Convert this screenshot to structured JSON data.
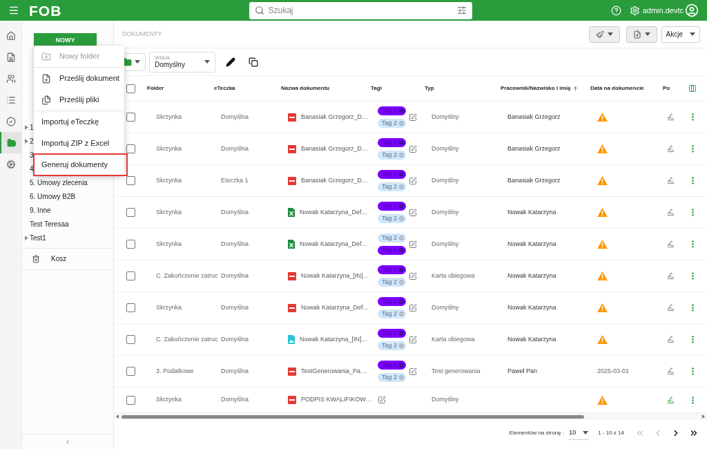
{
  "top_bar": {
    "logo": "FOB",
    "search": {
      "placeholder": "Szukaj"
    },
    "user": "admin.devtc"
  },
  "rail": [
    {
      "selected": false
    },
    {
      "selected": false
    },
    {
      "selected": false
    },
    {
      "selected": false
    },
    {
      "selected": false
    },
    {
      "selected": true
    },
    {
      "selected": false
    }
  ],
  "sidebar": {
    "new_button": "NOWY",
    "tree": [
      {
        "label": "1",
        "expandable": true
      },
      {
        "label": "2",
        "expandable": true
      },
      {
        "label": "3",
        "expandable": false
      },
      {
        "label": "4",
        "expandable": false
      },
      {
        "label": "5. Umowy zlecenia",
        "expandable": false
      },
      {
        "label": "6. Umowy B2B",
        "expandable": false
      },
      {
        "label": "9. Inne",
        "expandable": false
      },
      {
        "label": "Test Teresaa",
        "expandable": false
      },
      {
        "label": "Test1",
        "expandable": true
      }
    ],
    "trash": "Kosz"
  },
  "new_menu": {
    "sections": [
      [
        {
          "label": "Nowy folder",
          "kind": "folder",
          "disabled": true,
          "highlighted": false
        }
      ],
      [
        {
          "label": "Prześlij dokument",
          "kind": "upload",
          "disabled": false,
          "highlighted": false
        },
        {
          "label": "Prześlij pliki",
          "kind": "files",
          "disabled": false,
          "highlighted": false
        }
      ],
      [
        {
          "label": "Importuj eTeczkę",
          "disabled": false,
          "highlighted": false
        },
        {
          "label": "Importuj ZIP z Excel",
          "disabled": false,
          "highlighted": false
        },
        {
          "label": "Generuj dokumenty",
          "disabled": false,
          "highlighted": true
        }
      ]
    ]
  },
  "breadcrumb": "DOKUMENTY",
  "actions_button": "Akcje",
  "view_select": {
    "label": "Widok",
    "value": "Domyślny"
  },
  "table": {
    "columns": [
      {
        "label": "Folder",
        "sorted": false
      },
      {
        "label": "eTeczka",
        "sorted": false
      },
      {
        "label": "Nazwa dokumentu",
        "sorted": false
      },
      {
        "label": "Tagi",
        "sorted": false
      },
      {
        "label": "Typ",
        "sorted": false
      },
      {
        "label": "Pracownik/Nazwisko i imię",
        "sorted": true
      },
      {
        "label": "Data na dokumencie",
        "sorted": false
      },
      {
        "label": "Po",
        "sorted": false
      }
    ],
    "header_checked": false,
    "rows": [
      {
        "checked": false,
        "folder": "Skrzynka",
        "eteczka": "Domyślna",
        "kind": "pdf",
        "name": "Banasiak Grzegorz_D…",
        "tags": [
          {
            "label": "Tag 1",
            "color": "#7b00ff"
          },
          {
            "label": "Tag 2",
            "color": "#cfe6fa"
          }
        ],
        "type": "Domyślny",
        "employee": "Banasiak Grzegorz",
        "date_warning": true,
        "signed": false
      },
      {
        "checked": false,
        "folder": "Skrzynka",
        "eteczka": "Domyślna",
        "kind": "pdf",
        "name": "Banasiak Grzegorz_D…",
        "tags": [
          {
            "label": "Tag 1",
            "color": "#7b00ff"
          },
          {
            "label": "Tag 2",
            "color": "#cfe6fa"
          }
        ],
        "type": "Domyślny",
        "employee": "Banasiak Grzegorz",
        "date_warning": true,
        "signed": false
      },
      {
        "checked": false,
        "folder": "Skrzynka",
        "eteczka": "Eteczka 1",
        "kind": "pdf",
        "name": "Banasiak Grzegorz_D…",
        "tags": [
          {
            "label": "Tag 1",
            "color": "#7b00ff"
          },
          {
            "label": "Tag 2",
            "color": "#cfe6fa"
          }
        ],
        "type": "Domyślny",
        "employee": "Banasiak Grzegorz",
        "date_warning": true,
        "signed": false
      },
      {
        "checked": false,
        "folder": "Skrzynka",
        "eteczka": "Domyślna",
        "kind": "excel",
        "name": "Nowak Katarzyna_Def…",
        "tags": [
          {
            "label": "Tag 1",
            "color": "#7b00ff"
          },
          {
            "label": "Tag 2",
            "color": "#cfe6fa"
          }
        ],
        "type": "Domyślny",
        "employee": "Nowak Katarzyna",
        "date_warning": true,
        "signed": false
      },
      {
        "checked": false,
        "folder": "Skrzynka",
        "eteczka": "Domyślna",
        "kind": "excel",
        "name": "Nowak Katarzyna_Def…",
        "tags": [
          {
            "label": "Tag 2",
            "color": "#cfe6fa"
          },
          {
            "label": "Tag 1",
            "color": "#7b00ff"
          }
        ],
        "type": "Domyślny",
        "employee": "Nowak Katarzyna",
        "date_warning": true,
        "signed": false
      },
      {
        "checked": false,
        "folder": "C. Zakończenie zatruc",
        "eteczka": "Domyślna",
        "kind": "pdf",
        "name": "Nowak Katarzyna_[IN]…",
        "tags": [
          {
            "label": "Tag 1",
            "color": "#7b00ff"
          },
          {
            "label": "Tag 2",
            "color": "#cfe6fa"
          }
        ],
        "type": "Karta obiegowa",
        "employee": "Nowak Katarzyna",
        "date_warning": true,
        "signed": false
      },
      {
        "checked": false,
        "folder": "Skrzynka",
        "eteczka": "Domyślna",
        "kind": "pdf",
        "name": "Nowak Katarzyna_Def…",
        "tags": [
          {
            "label": "Tag 1",
            "color": "#7b00ff"
          },
          {
            "label": "Tag 2",
            "color": "#cfe6fa"
          }
        ],
        "type": "Domyślny",
        "employee": "Nowak Katarzyna",
        "date_warning": true,
        "signed": false
      },
      {
        "checked": false,
        "folder": "C. Zakończenie zatruc",
        "eteczka": "Domyślna",
        "kind": "image",
        "name": "Nowak Katarzyna_[IN]…",
        "tags": [
          {
            "label": "Tag 1",
            "color": "#7b00ff"
          },
          {
            "label": "Tag 2",
            "color": "#cfe6fa"
          }
        ],
        "type": "Karta obiegowa",
        "employee": "Nowak Katarzyna",
        "date_warning": true,
        "signed": false
      },
      {
        "checked": false,
        "folder": "3. Podatkowe",
        "eteczka": "Domyślna",
        "kind": "pdf",
        "name": "TestGenerowania_Pa…",
        "tags": [
          {
            "label": "Tag 1",
            "color": "#7b00ff"
          },
          {
            "label": "Tag 2",
            "color": "#cfe6fa"
          }
        ],
        "type": "Test generowania",
        "employee": "Paweł Pan",
        "date": "2025-03-01",
        "date_warning": false,
        "signed": false
      },
      {
        "checked": false,
        "folder": "Skrzynka",
        "eteczka": "Domyślna",
        "kind": "pdf",
        "name": "PODPIS KWALIFIKOW…",
        "type": "Domyślny",
        "date_warning": true,
        "signed": true
      }
    ]
  },
  "pagination": {
    "label": "Elementów na stronę :",
    "page_size": "10",
    "range": "1 - 10 z 14",
    "nav": [
      {
        "kind": "first",
        "disabled": true
      },
      {
        "kind": "prev",
        "disabled": true
      },
      {
        "kind": "next",
        "disabled": false
      },
      {
        "kind": "last",
        "disabled": false
      }
    ]
  }
}
